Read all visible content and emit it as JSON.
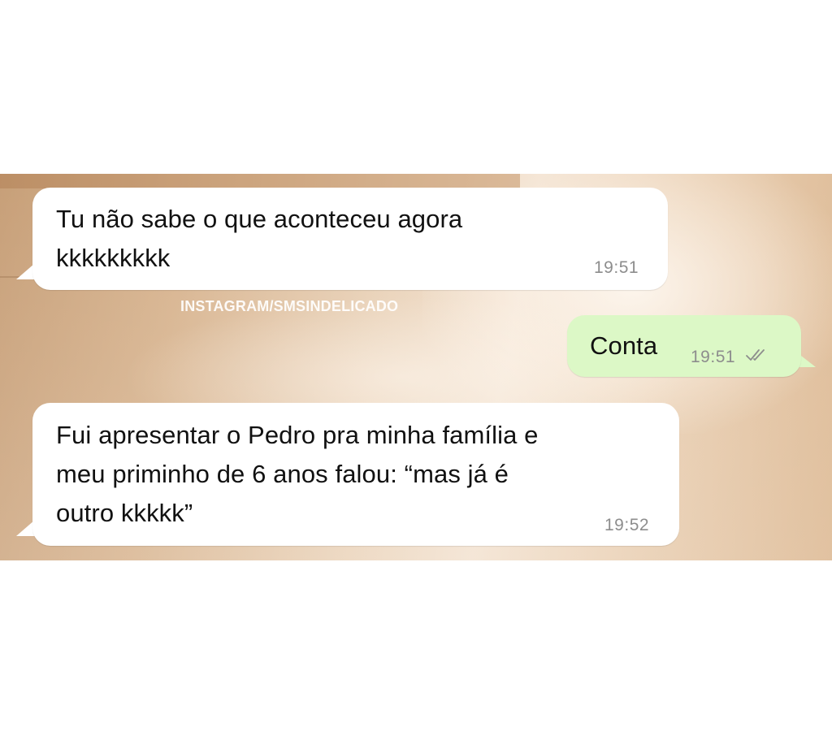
{
  "watermark": "INSTAGRAM/SMSINDELICADO",
  "colors": {
    "incoming_bubble": "#ffffff",
    "outgoing_bubble": "#dcf8c6",
    "timestamp": "#8d8d8d",
    "read_ticks": "#8d8d8d"
  },
  "messages": [
    {
      "direction": "incoming",
      "lines": [
        "Tu não sabe o que aconteceu agora",
        "kkkkkkkkk"
      ],
      "time": "19:51"
    },
    {
      "direction": "outgoing",
      "lines": [
        "Conta"
      ],
      "time": "19:51",
      "status_icon": "double-check-icon"
    },
    {
      "direction": "incoming",
      "lines": [
        "Fui apresentar o Pedro pra minha família e",
        "meu priminho de 6 anos falou: “mas já é",
        "outro kkkkk”"
      ],
      "time": "19:52"
    }
  ]
}
